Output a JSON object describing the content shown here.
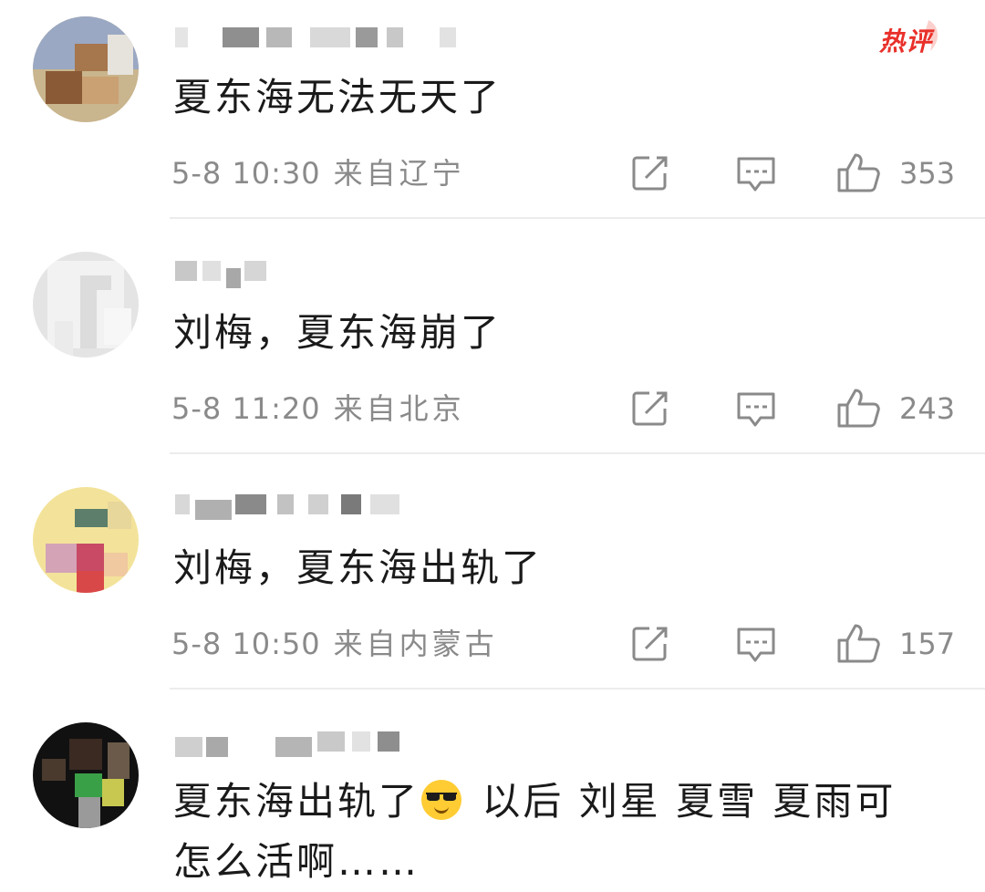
{
  "hot_badge_label": "热评",
  "comments": [
    {
      "text": "夏东海无法无天了",
      "time": "5-8 10:30",
      "location": "来自辽宁",
      "likes": "353"
    },
    {
      "text": "刘梅，夏东海崩了",
      "time": "5-8 11:20",
      "location": "来自北京",
      "likes": "243"
    },
    {
      "text": "刘梅，夏东海出轨了",
      "time": "5-8 10:50",
      "location": "来自内蒙古",
      "likes": "157"
    },
    {
      "text_before_emoji": "夏东海出轨了",
      "emoji": "smiling-face-with-sunglasses",
      "text_after_emoji": " 以后 刘星 夏雪 夏雨可怎么活啊……"
    }
  ],
  "icons": {
    "share": "edit-share-icon",
    "reply": "comment-bubble-icon",
    "like": "thumbs-up-icon"
  },
  "colors": {
    "text": "#1a1a1a",
    "meta": "#8a8a8a",
    "divider": "#ececec",
    "hot": "#e9302a"
  }
}
